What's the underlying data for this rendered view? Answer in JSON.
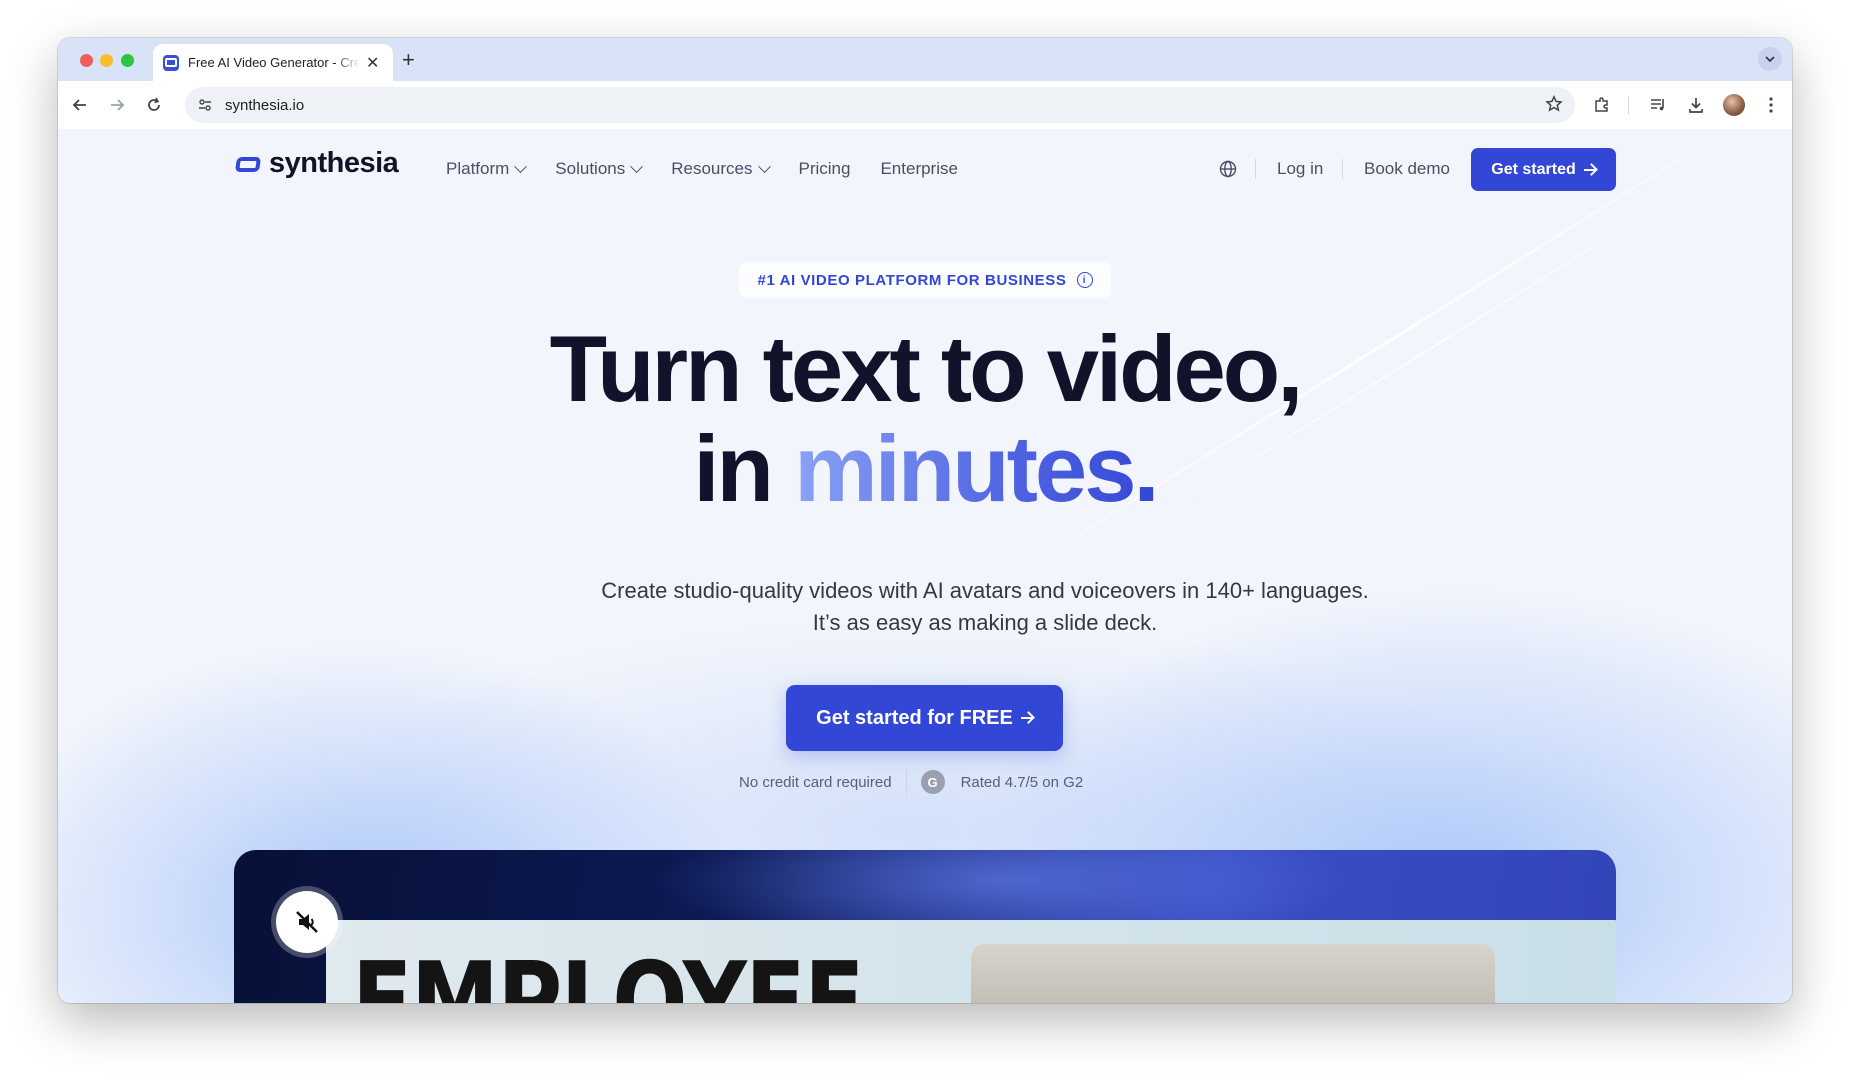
{
  "browser": {
    "tab_title": "Free AI Video Generator - Create AI Videos",
    "tab_close": "✕",
    "new_tab": "+",
    "url": "synthesia.io"
  },
  "nav": {
    "logo_text": "synthesia",
    "items": [
      {
        "label": "Platform",
        "has_dropdown": true
      },
      {
        "label": "Solutions",
        "has_dropdown": true
      },
      {
        "label": "Resources",
        "has_dropdown": true
      },
      {
        "label": "Pricing",
        "has_dropdown": false
      },
      {
        "label": "Enterprise",
        "has_dropdown": false
      }
    ],
    "login": "Log in",
    "book_demo": "Book demo",
    "cta": "Get started"
  },
  "hero": {
    "badge": "#1 AI VIDEO PLATFORM FOR BUSINESS",
    "badge_info": "i",
    "headline_line1": "Turn text to video,",
    "headline_line2_prefix": "in",
    "headline_line2_accent": "minutes.",
    "subheadline": "Create studio-quality videos with AI avatars and voiceovers in 140+ languages. It’s as easy as making a slide deck.",
    "cta": "Get started for FREE",
    "trust_left": "No credit card required",
    "g2_logo": "G",
    "trust_right": "Rated 4.7/5 on G2"
  },
  "video": {
    "slide_title": "EMPLOYEE"
  },
  "colors": {
    "brand": "#3347d6",
    "headline": "#10132a",
    "background": "#f2f5fb"
  }
}
